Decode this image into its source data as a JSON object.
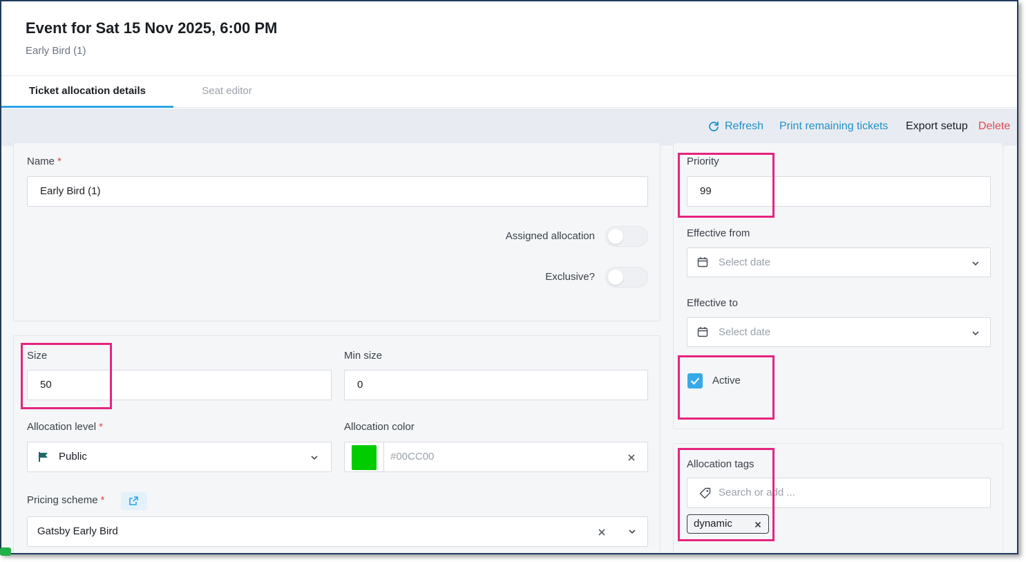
{
  "header": {
    "title": "Event for Sat 15 Nov 2025, 6:00 PM",
    "subtitle": "Early Bird (1)"
  },
  "tabs": [
    {
      "label": "Ticket allocation details",
      "active": true
    },
    {
      "label": "Seat editor",
      "active": false
    }
  ],
  "toolbar": {
    "refresh_label": "Refresh",
    "print_label": "Print remaining tickets",
    "export_label": "Export setup",
    "delete_label": "Delete"
  },
  "form": {
    "name": {
      "label": "Name",
      "required": "*",
      "value": "Early Bird  (1)"
    },
    "assigned_allocation": {
      "label": "Assigned allocation",
      "on": false
    },
    "exclusive": {
      "label": "Exclusive?",
      "on": false
    },
    "size": {
      "label": "Size",
      "value": "50"
    },
    "min_size": {
      "label": "Min size",
      "value": "0"
    },
    "allocation_level": {
      "label": "Allocation level",
      "required": "*",
      "value": "Public"
    },
    "allocation_color": {
      "label": "Allocation color",
      "placeholder": "#00CC00",
      "swatch": "#00CC00"
    },
    "pricing_scheme": {
      "label": "Pricing scheme",
      "required": "*",
      "value": "Gatsby Early Bird"
    },
    "priority": {
      "label": "Priority",
      "value": "99"
    },
    "effective_from": {
      "label": "Effective from",
      "placeholder": "Select date"
    },
    "effective_to": {
      "label": "Effective to",
      "placeholder": "Select date"
    },
    "active": {
      "label": "Active",
      "checked": true
    },
    "allocation_tags": {
      "label": "Allocation tags",
      "placeholder": "Search or add ...",
      "tags": [
        "dynamic"
      ]
    }
  },
  "colors": {
    "accent": "#2ea3e6",
    "link": "#1f8fc7",
    "danger": "#e0474c",
    "highlight": "#e6237e",
    "swatch": "#00cc00"
  },
  "icons": [
    "refresh-icon",
    "flag-icon",
    "external-link-icon",
    "calendar-icon",
    "chevron-down-icon",
    "tag-icon",
    "close-icon",
    "check-icon"
  ]
}
